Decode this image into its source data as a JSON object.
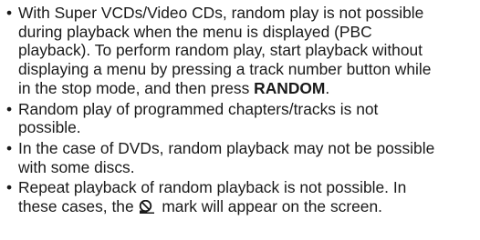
{
  "notes": [
    {
      "bullet": "•",
      "lines": [
        "With Super VCDs/Video CDs, random play is not possible",
        "during playback when the menu is displayed (PBC",
        "playback). To perform random play, start playback without",
        "displaying a menu by pressing a track number button while",
        "in the stop mode, and then press "
      ],
      "bold_text": "RANDOM",
      "trailing_text": "."
    },
    {
      "bullet": "•",
      "lines": [
        "Random play of programmed chapters/tracks is not",
        "possible."
      ]
    },
    {
      "bullet": "•",
      "lines": [
        "In the case of DVDs, random playback may not be possible",
        "with some discs."
      ]
    },
    {
      "bullet": "•",
      "lines": [
        "Repeat playback of random playback is not possible. In",
        "these cases, the "
      ],
      "icon": "prohibited-operation-icon",
      "trailing_text": " mark will appear on the screen."
    }
  ]
}
